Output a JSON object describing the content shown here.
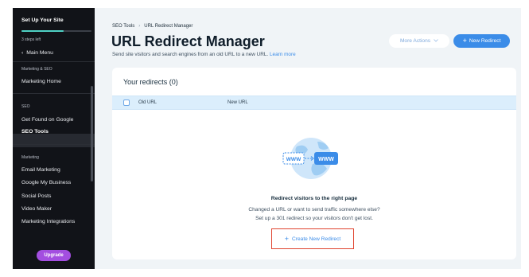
{
  "sidebar": {
    "setup_title": "Set Up Your Site",
    "setup_progress": 0.6,
    "steps_left": "3 steps left",
    "main_menu": "Main Menu",
    "section_marketing_seo": "Marketing & SEO",
    "marketing_home": "Marketing Home",
    "section_seo": "SEO",
    "get_found": "Get Found on Google",
    "seo_tools": "SEO Tools",
    "section_marketing": "Marketing",
    "items": [
      "Email Marketing",
      "Google My Business",
      "Social Posts",
      "Video Maker",
      "Marketing Integrations"
    ],
    "upgrade": "Upgrade"
  },
  "header": {
    "breadcrumb": [
      "SEO Tools",
      "URL Redirect Manager"
    ],
    "title": "URL Redirect Manager",
    "subtitle": "Send site visitors and search engines from an old URL to a new URL.",
    "learn_more": "Learn more",
    "more_actions": "More Actions",
    "new_redirect": "New Redirect"
  },
  "card": {
    "title": "Your redirects (0)",
    "columns": [
      "Old URL",
      "New URL"
    ],
    "illustration_text": [
      "WWW",
      "WWW"
    ],
    "empty_title": "Redirect visitors to the right page",
    "empty_line1": "Changed a URL or want to send traffic somewhere else?",
    "empty_line2": "Set up a 301 redirect so your visitors don't get lost.",
    "create_button": "Create New Redirect"
  },
  "colors": {
    "accent": "#3b8ce8",
    "sidebar_bg": "#111318",
    "upgrade": "#a34ee0",
    "highlight_box": "#e0442f"
  }
}
